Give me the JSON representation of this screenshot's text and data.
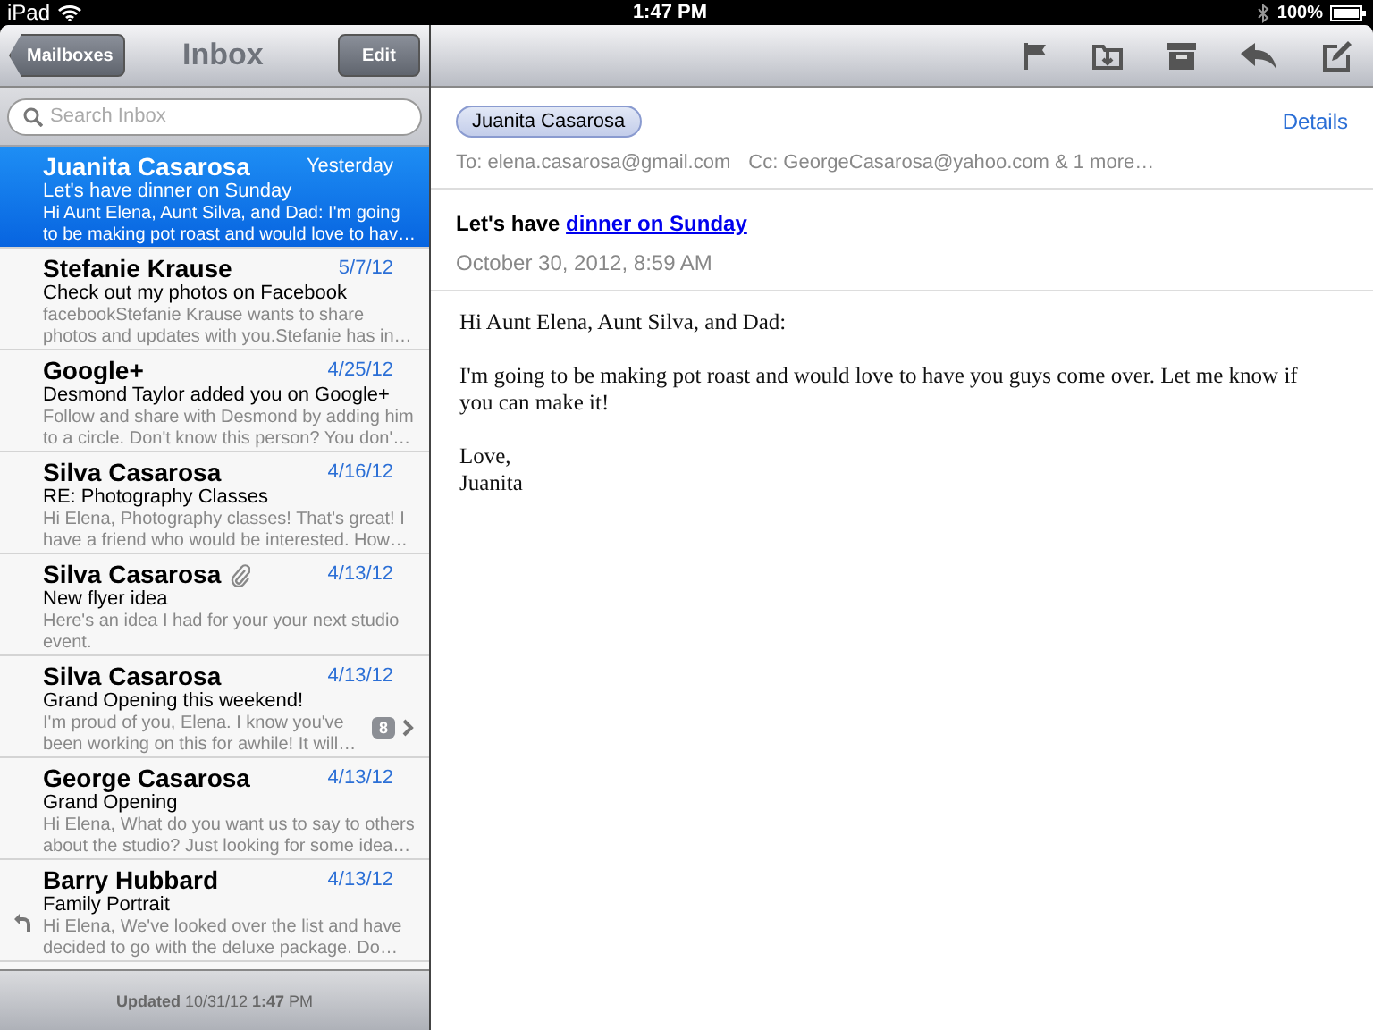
{
  "status_bar": {
    "device": "iPad",
    "time": "1:47 PM",
    "battery": "100%"
  },
  "list_pane": {
    "back_button": "Mailboxes",
    "title": "Inbox",
    "edit_button": "Edit",
    "search": {
      "placeholder": "Search Inbox"
    },
    "messages": [
      {
        "sender": "Juanita Casarosa",
        "date": "Yesterday",
        "subject": "Let's have dinner on Sunday",
        "preview_lines": [
          "Hi Aunt Elena, Aunt Silva, and Dad: I'm going",
          "to be making pot roast and would love to hav…"
        ],
        "selected": true,
        "attachment": false,
        "replied": false
      },
      {
        "sender": "Stefanie Krause",
        "date": "5/7/12",
        "subject": "Check out my photos on Facebook",
        "preview_lines": [
          "facebookStefanie Krause wants to share",
          "photos and updates with you.Stefanie has in…"
        ],
        "selected": false,
        "attachment": false,
        "replied": false
      },
      {
        "sender": "Google+",
        "date": "4/25/12",
        "subject": "Desmond Taylor added you on Google+",
        "preview_lines": [
          "Follow and share with Desmond by adding him",
          "to a circle. Don't know this person? You don'…"
        ],
        "selected": false,
        "attachment": false,
        "replied": false
      },
      {
        "sender": "Silva Casarosa",
        "date": "4/16/12",
        "subject": "RE: Photography Classes",
        "preview_lines": [
          "Hi Elena, Photography classes! That's great! I",
          "have a friend who would be interested. How…"
        ],
        "selected": false,
        "attachment": false,
        "replied": false
      },
      {
        "sender": "Silva Casarosa",
        "date": "4/13/12",
        "subject": "New flyer idea",
        "preview_lines": [
          "Here's an idea I had for your your next studio",
          "event."
        ],
        "selected": false,
        "attachment": true,
        "replied": false
      },
      {
        "sender": "Silva Casarosa",
        "date": "4/13/12",
        "subject": "Grand Opening this weekend!",
        "preview_lines": [
          "I'm proud of you, Elena. I know you've",
          "been working on this for awhile! It will…"
        ],
        "selected": false,
        "attachment": false,
        "replied": false,
        "thread_count": "8"
      },
      {
        "sender": "George Casarosa",
        "date": "4/13/12",
        "subject": "Grand Opening",
        "preview_lines": [
          "Hi Elena, What do you want us to say to others",
          "about the studio? Just looking for some idea…"
        ],
        "selected": false,
        "attachment": false,
        "replied": false
      },
      {
        "sender": "Barry Hubbard",
        "date": "4/13/12",
        "subject": "Family Portrait",
        "preview_lines": [
          "Hi Elena, We've looked over the list and have",
          "decided to go with the deluxe package. Do…"
        ],
        "selected": false,
        "attachment": false,
        "replied": true
      }
    ],
    "footer": "**Updated** 10/31/12 **1:47** PM"
  },
  "message_pane": {
    "from": "Juanita Casarosa",
    "details_link": "Details",
    "to": "To: elena.casarosa@gmail.com",
    "cc": "Cc: GeorgeCasarosa@yahoo.com & 1 more…",
    "subject_prefix": "Let's have",
    "subject_link": "dinner on Sunday",
    "date": "October 30, 2012, 8:59 AM",
    "body": [
      "Hi Aunt Elena, Aunt Silva, and Dad:",
      "I'm going to be making pot roast and would love to have you guys come over. Let me know if you can make it!",
      "Love,\nJuanita"
    ]
  }
}
